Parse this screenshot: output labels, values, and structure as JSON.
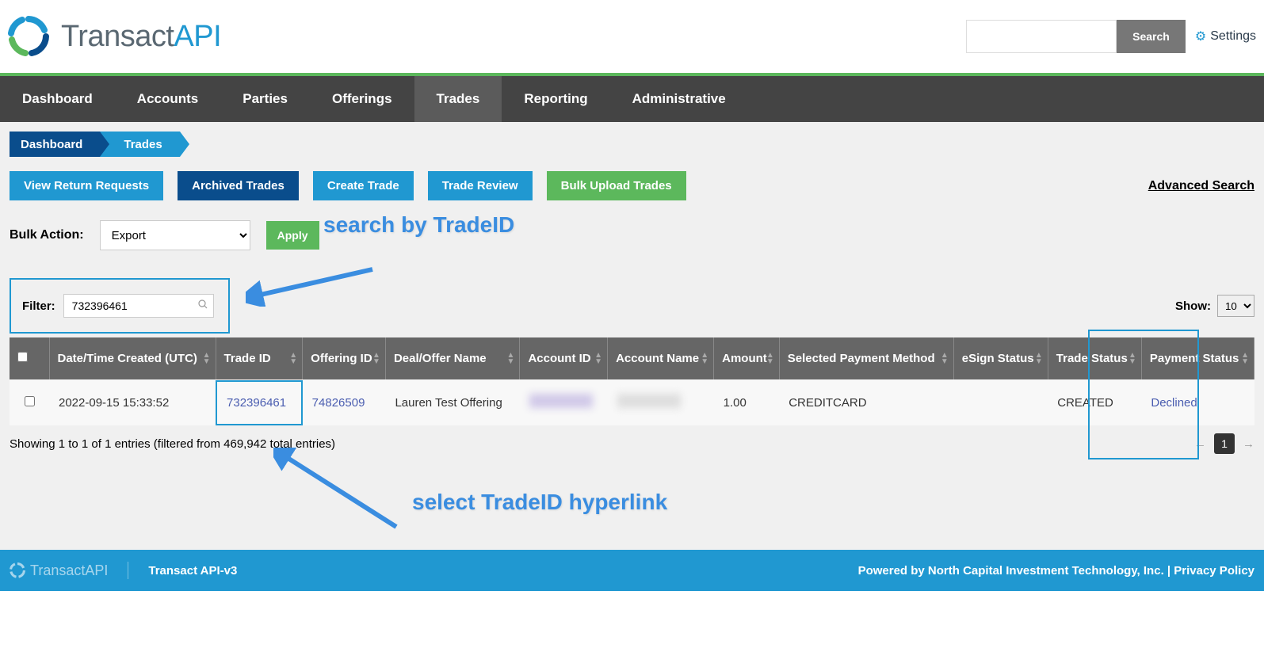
{
  "header": {
    "logo_text_1": "Transact",
    "logo_text_2": "API",
    "search_button": "Search",
    "settings_label": "Settings"
  },
  "nav": [
    {
      "label": "Dashboard",
      "active": false
    },
    {
      "label": "Accounts",
      "active": false
    },
    {
      "label": "Parties",
      "active": false
    },
    {
      "label": "Offerings",
      "active": false
    },
    {
      "label": "Trades",
      "active": true
    },
    {
      "label": "Reporting",
      "active": false
    },
    {
      "label": "Administrative",
      "active": false
    }
  ],
  "breadcrumb": [
    {
      "label": "Dashboard"
    },
    {
      "label": "Trades"
    }
  ],
  "actions": [
    {
      "label": "View Return Requests",
      "style": "blue"
    },
    {
      "label": "Archived Trades",
      "style": "dark"
    },
    {
      "label": "Create Trade",
      "style": "blue"
    },
    {
      "label": "Trade Review",
      "style": "blue"
    },
    {
      "label": "Bulk Upload Trades",
      "style": "green"
    }
  ],
  "advanced_search": "Advanced Search",
  "bulk": {
    "label": "Bulk Action:",
    "selected": "Export",
    "apply": "Apply"
  },
  "filter": {
    "label": "Filter:",
    "value": "732396461"
  },
  "show": {
    "label": "Show:",
    "value": "10"
  },
  "columns": [
    "Date/Time Created (UTC)",
    "Trade ID",
    "Offering ID",
    "Deal/Offer Name",
    "Account ID",
    "Account Name",
    "Amount",
    "Selected Payment Method",
    "eSign Status",
    "Trade Status",
    "Payment Status"
  ],
  "rows": [
    {
      "datetime": "2022-09-15 15:33:52",
      "trade_id": "732396461",
      "offering_id": "74826509",
      "deal_name": "Lauren Test Offering",
      "account_id": "",
      "account_name": "",
      "amount": "1.00",
      "payment_method": "CREDITCARD",
      "esign": "",
      "trade_status": "CREATED",
      "payment_status": "Declined"
    }
  ],
  "table_info": "Showing 1 to 1 of 1 entries (filtered from 469,942 total entries)",
  "pager": {
    "current": "1"
  },
  "footer": {
    "logo": "TransactAPI",
    "version": "Transact API-v3",
    "powered": "Powered by North Capital Investment Technology, Inc. | Privacy Policy"
  },
  "annotations": {
    "a1": "search by TradeID",
    "a2": "select TradeID hyperlink"
  }
}
